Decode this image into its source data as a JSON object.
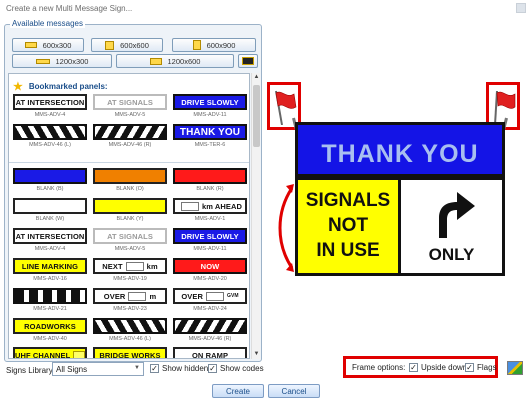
{
  "window": {
    "title": "Create a new Multi Message Sign..."
  },
  "panel": {
    "legend": "Available messages",
    "size_buttons": [
      "600x300",
      "600x600",
      "600x900",
      "1200x300",
      "1200x600"
    ],
    "bookmarked_label": "Bookmarked panels:"
  },
  "bookmarked": [
    {
      "text": "AT INTERSECTION",
      "code": "MMS-ADV-4"
    },
    {
      "text": "AT SIGNALS",
      "code": "MMS-ADV-5"
    },
    {
      "text": "DRIVE SLOWLY",
      "code": "MMS-ADV-11"
    },
    {
      "text": "",
      "code": "MMS-ADV-46 (L)"
    },
    {
      "text": "",
      "code": "MMS-ADV-46 (R)"
    },
    {
      "text": "THANK YOU",
      "code": "MMS-TER-6"
    }
  ],
  "library_signs": [
    {
      "text": "",
      "code": "BLANK (B)"
    },
    {
      "text": "",
      "code": "BLANK (O)"
    },
    {
      "text": "",
      "code": "BLANK (R)"
    },
    {
      "text": "",
      "code": "BLANK (W)"
    },
    {
      "text": "",
      "code": "BLANK (Y)"
    },
    {
      "text": "km  AHEAD",
      "code": "MMS-ADV-1"
    },
    {
      "text": "AT INTERSECTION",
      "code": "MMS-ADV-4"
    },
    {
      "text": "AT SIGNALS",
      "code": "MMS-ADV-5"
    },
    {
      "text": "DRIVE SLOWLY",
      "code": "MMS-ADV-11"
    },
    {
      "text": "LINE MARKING",
      "code": "MMS-ADV-16"
    },
    {
      "text": "NEXT",
      "suffix": "km",
      "code": "MMS-ADV-19"
    },
    {
      "text": "NOW",
      "code": "MMS-ADV-20"
    },
    {
      "text": "",
      "code": "MMS-ADV-21"
    },
    {
      "text": "OVER",
      "suffix": "m",
      "code": "MMS-ADV-23"
    },
    {
      "text": "OVER",
      "suffix": "GVM",
      "code": "MMS-ADV-24"
    },
    {
      "text": "ROADWORKS",
      "code": "MMS-ADV-40"
    },
    {
      "text": "",
      "code": "MMS-ADV-46 (L)"
    },
    {
      "text": "",
      "code": "MMS-ADV-46 (R)"
    },
    {
      "text": "UHF CHANNEL",
      "code": ""
    },
    {
      "text": "BRIDGE WORKS",
      "code": ""
    },
    {
      "text": "ON RAMP",
      "code": ""
    }
  ],
  "library": {
    "label": "Signs Library:",
    "value": "All Signs",
    "show_hidden": "Show hidden",
    "show_codes": "Show codes"
  },
  "preview": {
    "top_text": "THANK YOU",
    "left_lines": [
      "SIGNALS",
      "NOT",
      "IN USE"
    ],
    "right_text": "ONLY",
    "colors": {
      "top": "#1414e6",
      "left": "#ffff00",
      "right": "#ffffff",
      "flag": "#e02020"
    }
  },
  "frame_options": {
    "label": "Frame options:",
    "upside_down": "Upside down",
    "flags": "Flags"
  },
  "buttons": {
    "create": "Create",
    "cancel": "Cancel"
  }
}
